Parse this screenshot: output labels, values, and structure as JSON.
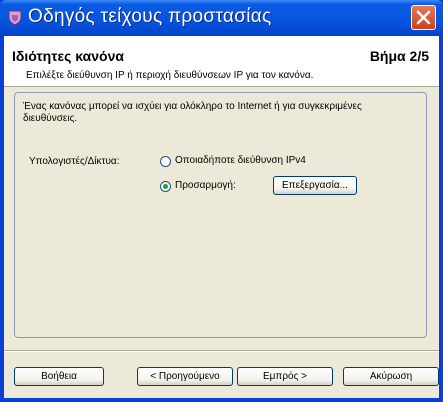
{
  "window": {
    "title": "Οδηγός τείχους προστασίας"
  },
  "header": {
    "title": "Ιδιότητες κανόνα",
    "step": "Βήμα 2/5",
    "subtitle": "Επιλέξτε διεύθυνση IP ή περιοχή διευθύνσεων IP για τον κανόνα."
  },
  "panel": {
    "description": "Ένας κανόνας μπορεί να ισχύει για ολόκληρο το Internet ή για συγκεκριμένες διευθύνσεις.",
    "computers_label": "Υπολογιστές/Δίκτυα:",
    "options": [
      {
        "label": "Οποιαδήποτε διεύθυνση IPv4",
        "selected": false
      },
      {
        "label": "Προσαρμογή:",
        "selected": true
      }
    ],
    "edit_button": "Επεξεργασία..."
  },
  "footer": {
    "help": "Βοήθεια",
    "back": "< Προηγούμενο",
    "next": "Εμπρός >",
    "cancel": "Ακύρωση"
  }
}
